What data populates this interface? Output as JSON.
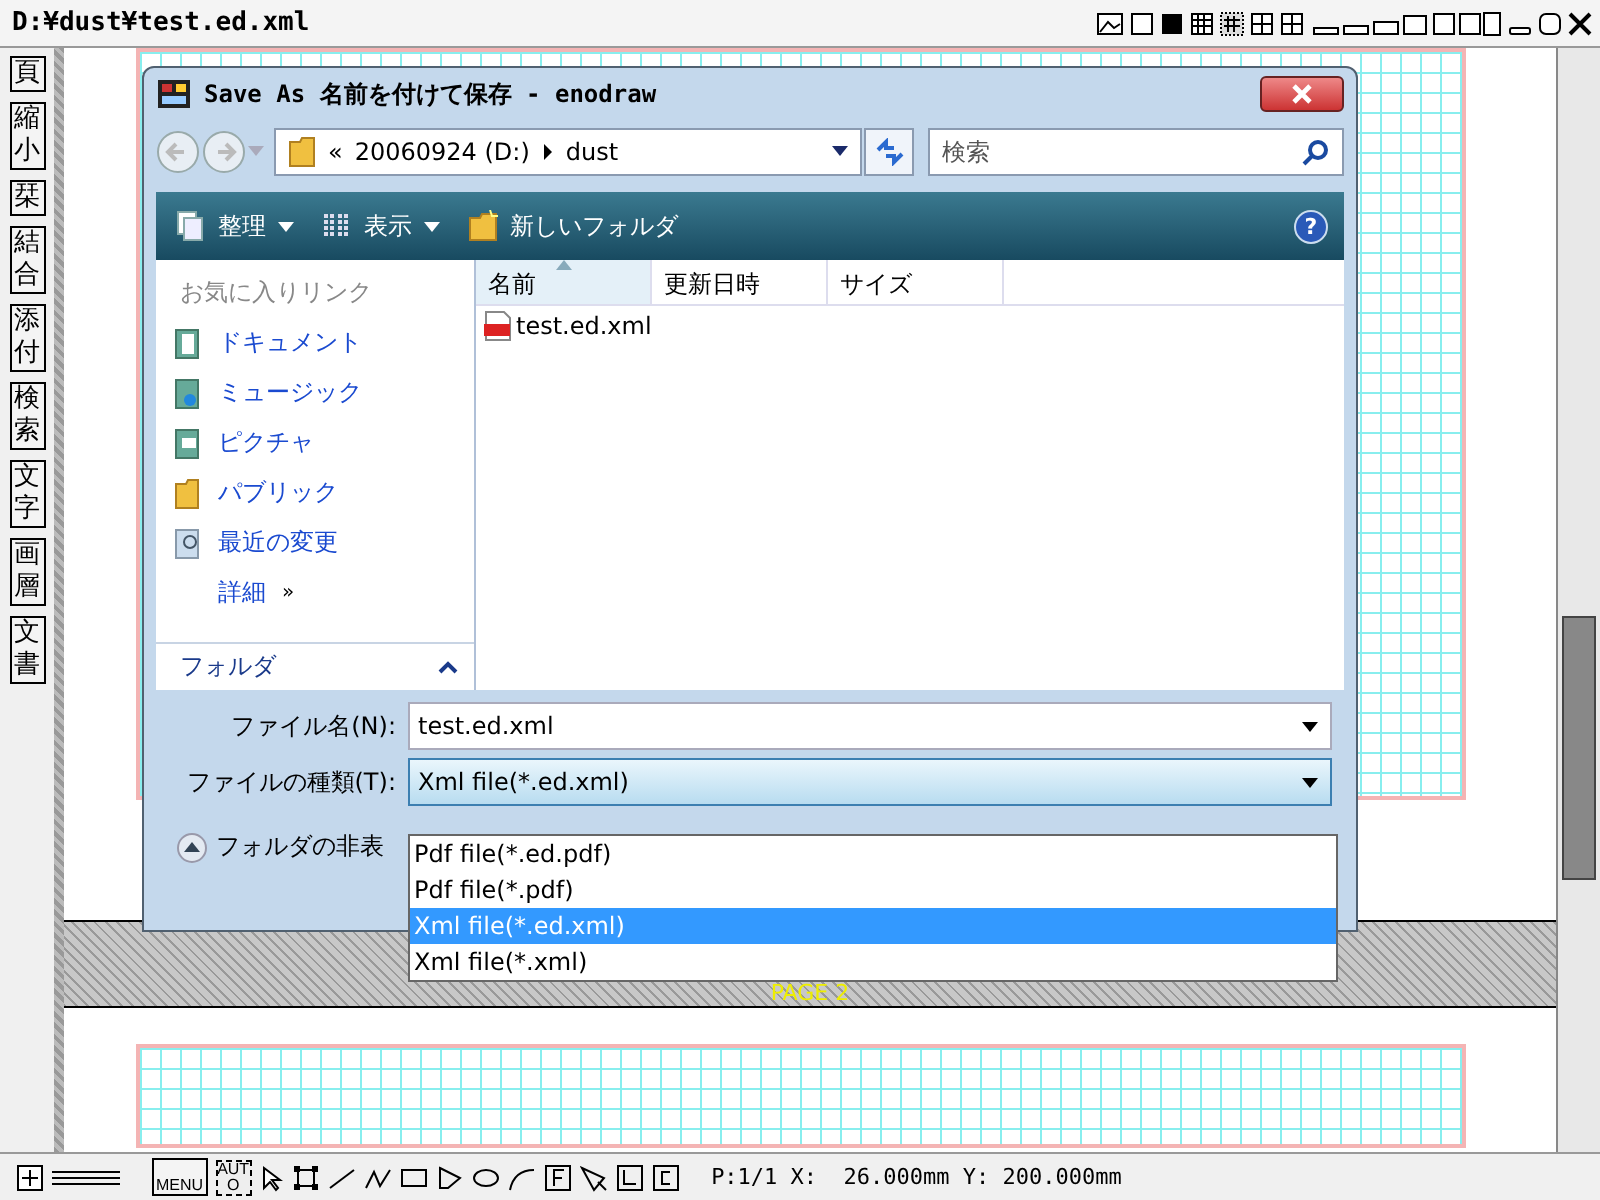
{
  "window": {
    "title": "D:¥dust¥test.ed.xml"
  },
  "side_toolbar": [
    {
      "label": "頁"
    },
    {
      "label": "縮小"
    },
    {
      "label": "栞"
    },
    {
      "label": "結合"
    },
    {
      "label": "添付"
    },
    {
      "label": "検索"
    },
    {
      "label": "文字"
    },
    {
      "label": "画層"
    },
    {
      "label": "文書"
    }
  ],
  "page_label": "PAGE 2",
  "dialog": {
    "title": "Save As 名前を付けて保存 - enodraw",
    "address": {
      "prefix": "«",
      "drive": "20060924 (D:)",
      "folder": "dust"
    },
    "search": {
      "placeholder": "検索"
    },
    "help_glyph": "?",
    "toolbar": [
      {
        "label": "整理",
        "kind": "organize",
        "dropdown": true
      },
      {
        "label": "表示",
        "kind": "views",
        "dropdown": true
      },
      {
        "label": "新しいフォルダ",
        "kind": "newfolder",
        "dropdown": false
      }
    ],
    "favorites": {
      "header": "お気に入りリンク",
      "items": [
        {
          "label": "ドキュメント",
          "kind": "documents"
        },
        {
          "label": "ミュージック",
          "kind": "music"
        },
        {
          "label": "ピクチャ",
          "kind": "pictures"
        },
        {
          "label": "パブリック",
          "kind": "public"
        },
        {
          "label": "最近の変更",
          "kind": "recent"
        }
      ],
      "more": "詳細",
      "more_glyph": "»"
    },
    "folders": {
      "label": "フォルダ",
      "expanded": false
    },
    "columns": [
      {
        "label": "名前",
        "sorted": true
      },
      {
        "label": "更新日時",
        "sorted": false
      },
      {
        "label": "サイズ",
        "sorted": false
      }
    ],
    "files": [
      {
        "name": "test.ed.xml"
      }
    ],
    "file_name": {
      "label": "ファイル名(N):",
      "value": "test.ed.xml"
    },
    "file_type": {
      "label": "ファイルの種類(T):",
      "value": "Xml file(*.ed.xml)",
      "expanded": true,
      "options": [
        {
          "label": "Pdf file(*.ed.pdf)",
          "selected": false
        },
        {
          "label": "Pdf file(*.pdf)",
          "selected": false
        },
        {
          "label": "Xml file(*.ed.xml)",
          "selected": true
        },
        {
          "label": "Xml file(*.xml)",
          "selected": false
        }
      ]
    },
    "hide_folders": "フォルダの非表"
  },
  "status_bar": {
    "menu_text": "MENU",
    "auto_text": "AUTO",
    "position": "P:1/1 X:  26.000mm Y: 200.000mm"
  }
}
